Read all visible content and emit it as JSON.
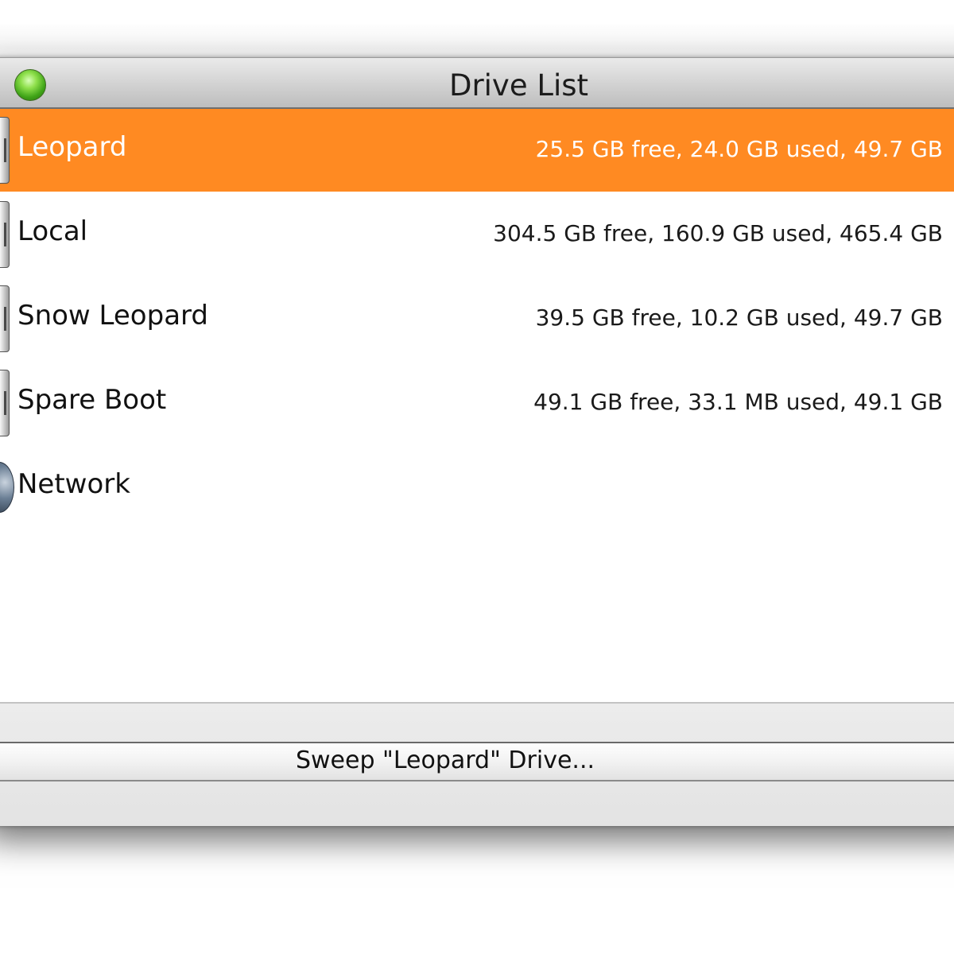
{
  "window": {
    "title": "Drive List"
  },
  "drives": [
    {
      "name": "Leopard",
      "info": "25.5 GB free, 24.0 GB used, 49.7 GB",
      "icon": "hard-disk-icon",
      "selected": true
    },
    {
      "name": "Local",
      "info": "304.5 GB free, 160.9 GB used, 465.4 GB",
      "icon": "hard-disk-icon",
      "selected": false
    },
    {
      "name": "Snow Leopard",
      "info": "39.5 GB free, 10.2 GB used, 49.7 GB",
      "icon": "hard-disk-icon",
      "selected": false
    },
    {
      "name": "Spare Boot",
      "info": "49.1 GB free, 33.1 MB used, 49.1 GB",
      "icon": "hard-disk-icon",
      "selected": false
    },
    {
      "name": "Network",
      "info": "",
      "icon": "network-globe-icon",
      "selected": false
    }
  ],
  "actions": {
    "sweep_label": "Sweep \"Leopard\" Drive..."
  },
  "colors": {
    "selection": "#ff8a22",
    "zoom_button": "#3fa317"
  }
}
